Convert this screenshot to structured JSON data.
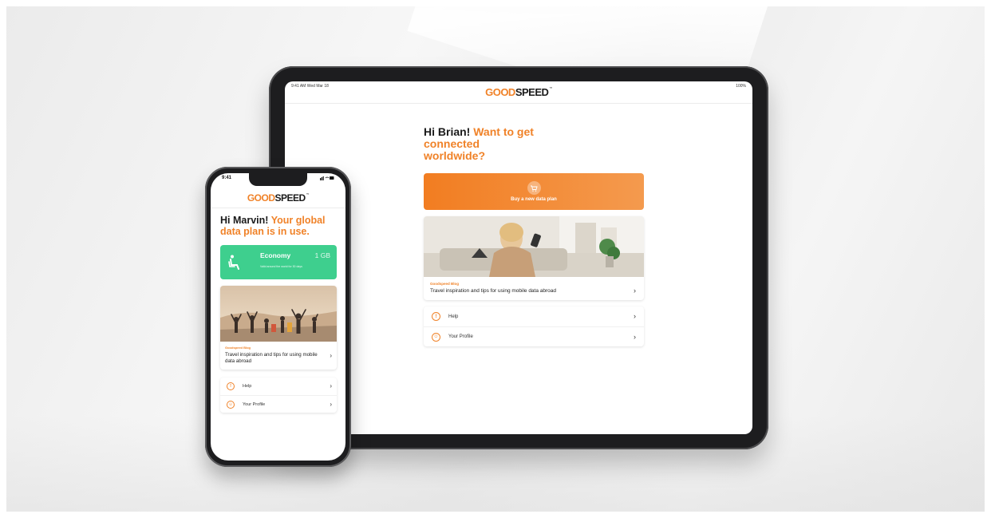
{
  "brand": {
    "good": "GOOD",
    "speed": "SPEED",
    "tm": "™",
    "accent": "#f08228",
    "green": "#3ecf8e"
  },
  "tablet": {
    "status_left": "9:41 AM  Wed Mar 18",
    "status_right": "100%",
    "greeting_name": "Hi Brian!",
    "greeting_rest": "Want to get connected worldwide?",
    "buy_label": "Buy a new data plan",
    "blog": {
      "tag": "Goodspeed Blog",
      "title": "Travel inspiration and tips for using mobile data abroad"
    },
    "menu": [
      {
        "icon": "info-icon",
        "glyph": "!",
        "label": "Help"
      },
      {
        "icon": "profile-icon",
        "glyph": "☺",
        "label": "Your Profile"
      }
    ]
  },
  "phone": {
    "time": "9:41",
    "greeting_name": "Hi Marvin!",
    "greeting_rest": "Your global data plan is in use.",
    "plan": {
      "name": "Economy",
      "size": "1 GB",
      "description": "Valid around the world for 30 days"
    },
    "blog": {
      "tag": "Goodspeed Blog",
      "title": "Travel inspiration and tips for using mobile data abroad"
    },
    "menu": [
      {
        "icon": "info-icon",
        "glyph": "!",
        "label": "Help"
      },
      {
        "icon": "profile-icon",
        "glyph": "☺",
        "label": "Your Profile"
      }
    ]
  }
}
